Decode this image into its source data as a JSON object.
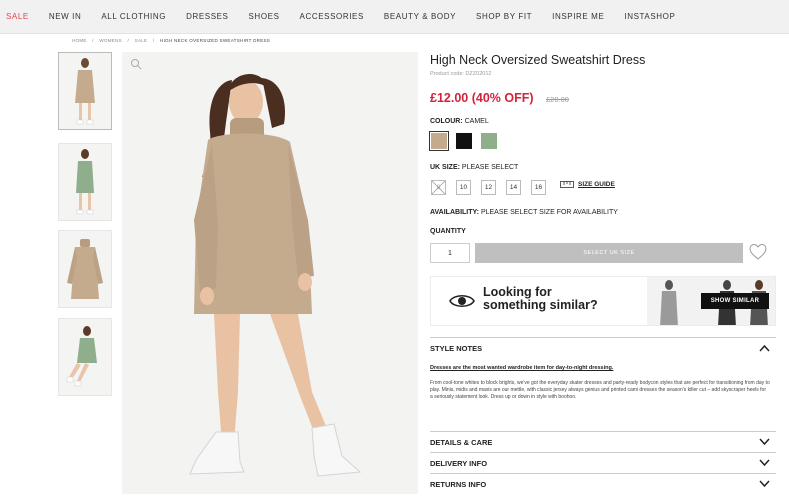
{
  "nav": {
    "items": [
      "SALE",
      "NEW IN",
      "ALL CLOTHING",
      "DRESSES",
      "SHOES",
      "ACCESSORIES",
      "BEAUTY & BODY",
      "SHOP BY FIT",
      "INSPIRE ME",
      "INSTASHOP"
    ]
  },
  "breadcrumb": [
    "HOME",
    "/",
    "WOMENS",
    "/",
    "SALE",
    "/",
    "HIGH NECK OVERSIZED SWEATSHIRT DRESS"
  ],
  "product": {
    "title": "High Neck Oversized Sweatshirt Dress",
    "code": "Product code: DZZ02012",
    "price": "£12.00 (40% OFF)",
    "was_price": "£20.00",
    "colour_label": "COLOUR:",
    "colour_value": "CAMEL",
    "colours": [
      {
        "name": "camel",
        "hex": "#c4ab8e"
      },
      {
        "name": "black",
        "hex": "#111111"
      },
      {
        "name": "sage",
        "hex": "#8faf8c"
      }
    ],
    "size_label": "UK SIZE:",
    "size_value": "PLEASE SELECT",
    "sizes": [
      "8",
      "10",
      "12",
      "14",
      "16"
    ],
    "size_guide": "SIZE GUIDE",
    "availability_label": "AVAILABILITY:",
    "availability_value": "PLEASE SELECT SIZE FOR AVAILABILITY",
    "quantity_label": "QUANTITY",
    "quantity": "1",
    "add_button": "SELECT UK SIZE"
  },
  "similar": {
    "line1": "Looking for",
    "line2": "something similar?",
    "button": "SHOW SIMILAR"
  },
  "accordion": {
    "style_notes": "STYLE NOTES",
    "lead": "Dresses are the most wanted wardrobe item for day-to-night dressing.",
    "body": "From cool-tone whites to block brights, we've got the everyday skater dresses and party-ready bodycon styles that are perfect for transitioning from day to play. Minis, midis and maxis are our mettle, with classic jersey always genius and printed cami dresses the season's killer cut – add skyscraper heels for a seriously statement look. Dress up or down in style with boohoo.",
    "details": "DETAILS & CARE",
    "delivery": "DELIVERY INFO",
    "returns": "RETURNS INFO"
  },
  "colors": {
    "sale_red": "#e0464f",
    "price_red": "#d4223b",
    "disabled_btn": "#bfbfbf"
  }
}
